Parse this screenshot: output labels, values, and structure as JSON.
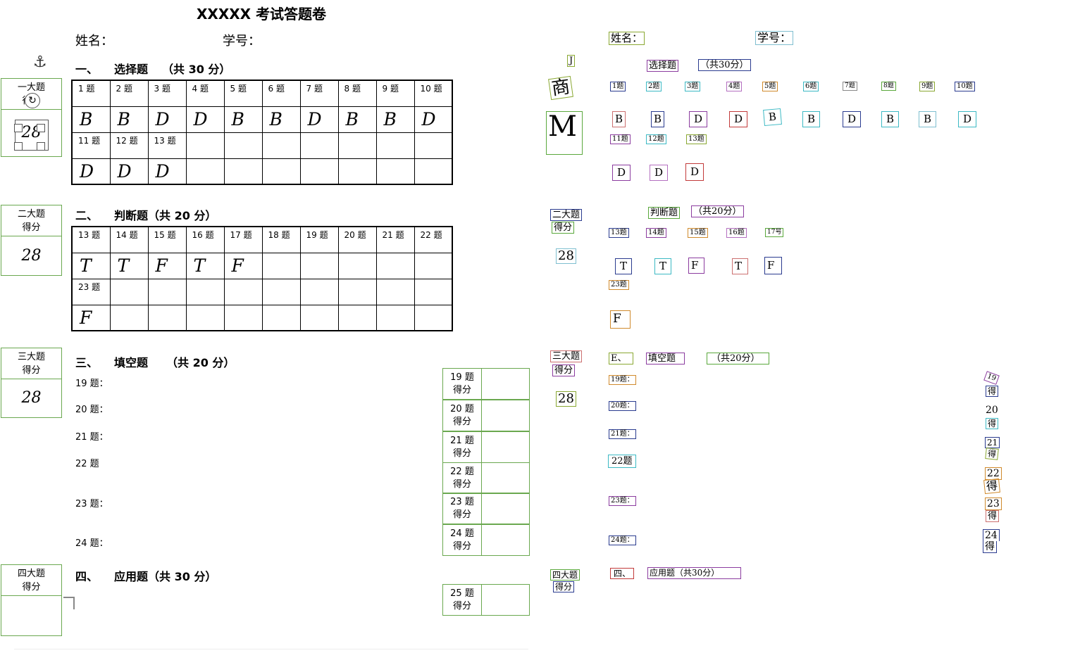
{
  "header": {
    "title": "XXXXX 考试答题卷",
    "name_label": "姓名：",
    "id_label": "学号："
  },
  "sections": {
    "s1": {
      "num": "一、",
      "name": "选择题",
      "points": "（共 30 分）",
      "score_header": "一大题\n得分",
      "score": "28"
    },
    "s2": {
      "num": "二、",
      "name": "判断题（共 20 分）",
      "score_header": "二大题\n得分",
      "score": "28"
    },
    "s3": {
      "num": "三、",
      "name": "填空题",
      "points": "（共 20 分）",
      "score_header": "三大题\n得分",
      "score": "28"
    },
    "s4": {
      "num": "四、",
      "name": "应用题（共 30 分）",
      "score_header": "四大题\n得分",
      "score": ""
    }
  },
  "choice_q": {
    "row1_headers": [
      "1 题",
      "2 题",
      "3 题",
      "4 题",
      "5 题",
      "6 题",
      "7 题",
      "8 题",
      "9 题",
      "10 题"
    ],
    "row1_answers": [
      "B",
      "B",
      "D",
      "D",
      "B",
      "B",
      "D",
      "B",
      "B",
      "D"
    ],
    "row2_headers": [
      "11 题",
      "12 题",
      "13 题",
      "",
      "",
      "",
      "",
      "",
      "",
      ""
    ],
    "row2_answers": [
      "D",
      "D",
      "D",
      "",
      "",
      "",
      "",
      "",
      "",
      ""
    ]
  },
  "judge_q": {
    "row1_headers": [
      "13 题",
      "14 题",
      "15 题",
      "16 题",
      "17 题",
      "18 题",
      "19 题",
      "20 题",
      "21 题",
      "22 题"
    ],
    "row1_answers": [
      "T",
      "T",
      "F",
      "T",
      "F",
      "",
      "",
      "",
      "",
      ""
    ],
    "row2_headers": [
      "23 题",
      "",
      "",
      "",
      "",
      "",
      "",
      "",
      "",
      ""
    ],
    "row2_answers": [
      "F",
      "",
      "",
      "",
      "",
      "",
      "",
      "",
      "",
      ""
    ]
  },
  "fill_q": [
    {
      "label": "19 题："
    },
    {
      "label": "20 题："
    },
    {
      "label": "21 题："
    },
    {
      "label": "22 题"
    },
    {
      "label": "23 题："
    },
    {
      "label": "24 题："
    }
  ],
  "q_scores": [
    "19 题\n得分",
    "20 题\n得分",
    "21 题\n得分",
    "22 题\n得分",
    "23 题\n得分",
    "24 题\n得分",
    "25 题\n得分"
  ],
  "annotations": {
    "header": [
      "J",
      "商",
      "M",
      "姓名：",
      "学号："
    ],
    "s1": [
      "选择题",
      "（共30分）",
      "1题",
      "2题",
      "3题",
      "4题",
      "5题",
      "6题",
      "7题",
      "8题",
      "9题",
      "10题",
      "B",
      "B",
      "D",
      "D",
      "B",
      "B",
      "D",
      "B",
      "B",
      "D",
      "11题",
      "12题",
      "13题",
      "D",
      "D",
      "D"
    ],
    "s2": [
      "二大题",
      "得分",
      "28",
      "判断题",
      "（共20分）",
      "13题",
      "14题",
      "15题",
      "16题",
      "17号",
      "T",
      "T",
      "F",
      "T",
      "F",
      "23题",
      "F"
    ],
    "s3": [
      "三大题",
      "得分",
      "28",
      "E、",
      "填空题",
      "（共20分）",
      "19题：",
      "20题：",
      "21题：",
      "22题",
      "23题：",
      "24题："
    ],
    "s3_right": [
      "19",
      "得",
      "20",
      "得",
      "21",
      "得",
      "22",
      "得",
      "23",
      "得",
      "24",
      "得"
    ],
    "s4": [
      "四大题",
      "得分",
      "四、",
      "应用题（共30分）"
    ]
  }
}
